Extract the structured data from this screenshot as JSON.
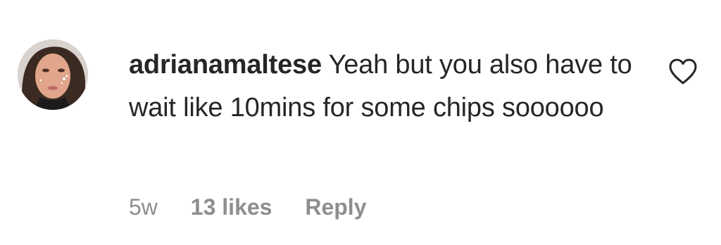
{
  "comment": {
    "username": "adrianamaltese",
    "text": "Yeah but you also have to wait like 10mins for some chips soooooo",
    "timestamp": "5w",
    "likes": "13 likes",
    "reply_label": "Reply",
    "avatar_icon": "profile-photo",
    "like_icon": "heart-outline-icon"
  }
}
